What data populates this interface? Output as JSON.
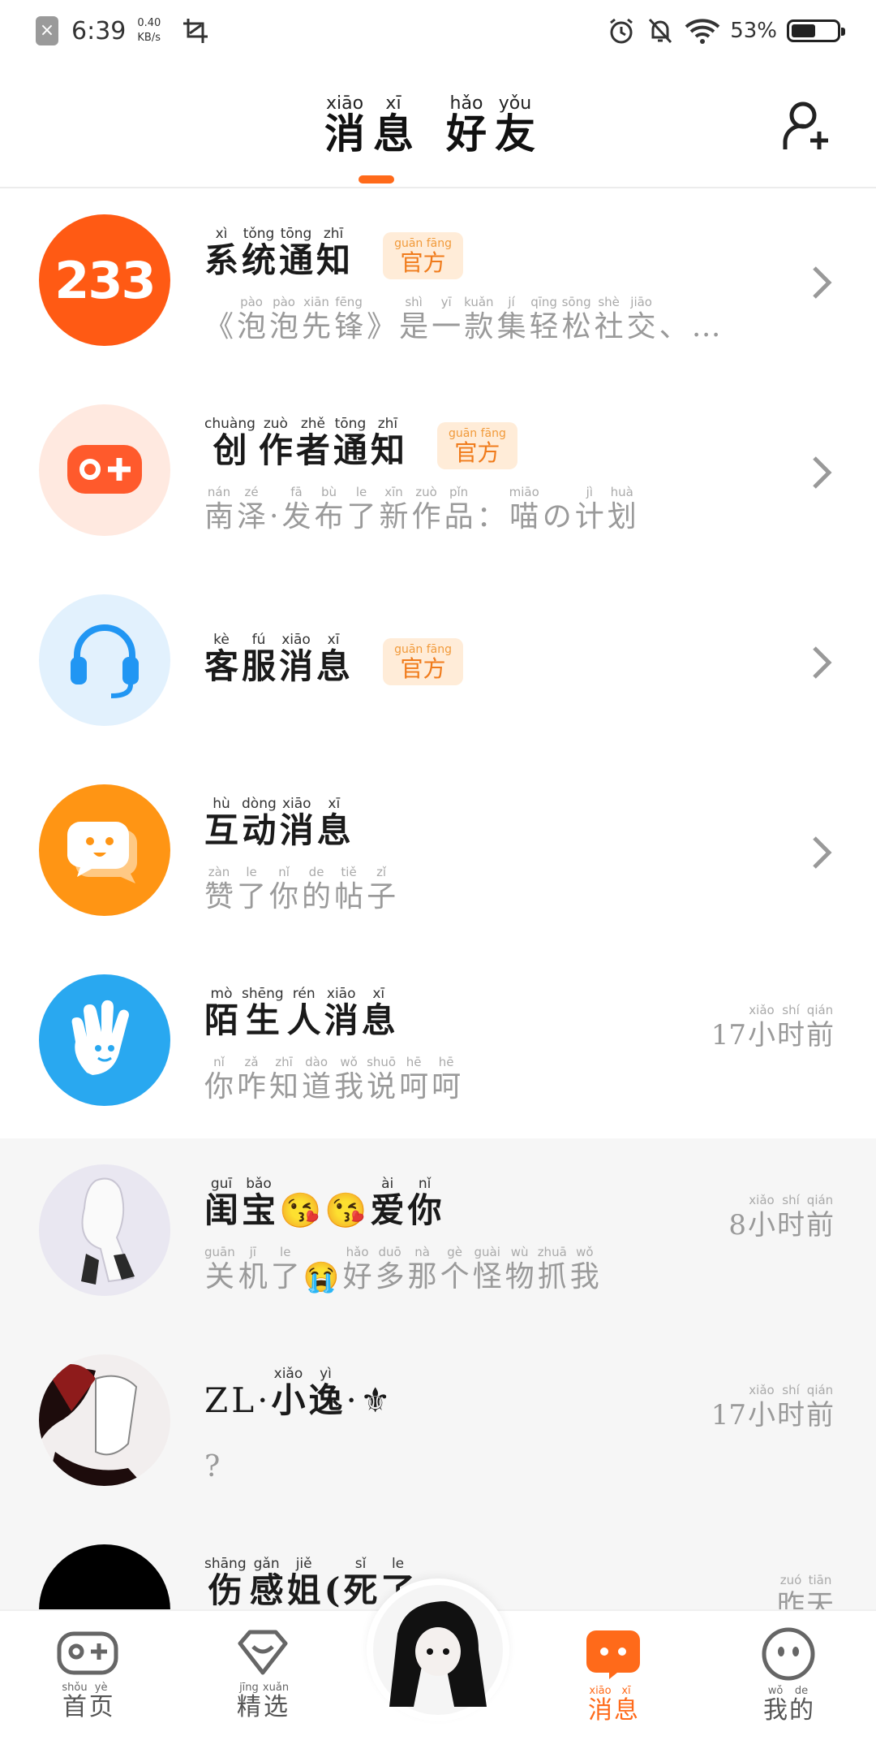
{
  "status_bar": {
    "time": "6:39",
    "speed_value": "0.40",
    "speed_unit": "KB/s",
    "battery_pct": "53%",
    "battery_level": 0.53
  },
  "header": {
    "tabs": [
      {
        "label": "消息",
        "pinyin": [
          "xiāo",
          "xī"
        ],
        "hanzi": [
          "消",
          "息"
        ],
        "active": true
      },
      {
        "label": "好友",
        "pinyin": [
          "hǎo",
          "yǒu"
        ],
        "hanzi": [
          "好",
          "友"
        ],
        "active": false
      }
    ],
    "add_friend_icon": "add-user-icon"
  },
  "rows": [
    {
      "title_pinyin": [
        "xì",
        "tǒng",
        "tōng",
        "zhī"
      ],
      "title_hanzi": [
        "系",
        "统",
        "通",
        "知"
      ],
      "official": true,
      "sub_pinyin": [
        "",
        "pào",
        "pào",
        "xiān",
        "fēng",
        "",
        "shì",
        "yī",
        "kuǎn",
        "jí",
        "qīng",
        "sōng",
        "shè",
        "jiāo",
        "",
        ""
      ],
      "sub_hanzi": [
        "《",
        "泡",
        "泡",
        "先",
        "锋",
        "》",
        "是",
        "一",
        "款",
        "集",
        "轻",
        "松",
        "社",
        "交",
        "、",
        "…"
      ],
      "right": "chevron"
    },
    {
      "title_pinyin": [
        "chuàng",
        "zuò",
        "zhě",
        "tōng",
        "zhī"
      ],
      "title_hanzi": [
        "创",
        "作",
        "者",
        "通",
        "知"
      ],
      "official": true,
      "sub_pinyin": [
        "nán",
        "zé",
        "",
        "fā",
        "bù",
        "le",
        "xīn",
        "zuò",
        "pǐn",
        "",
        "miāo",
        "",
        "jì",
        "huà"
      ],
      "sub_hanzi": [
        "南",
        "泽",
        "·",
        "发",
        "布",
        "了",
        "新",
        "作",
        "品",
        "：",
        "喵",
        "の",
        "计",
        "划"
      ],
      "right": "chevron"
    },
    {
      "title_pinyin": [
        "kè",
        "fú",
        "xiāo",
        "xī"
      ],
      "title_hanzi": [
        "客",
        "服",
        "消",
        "息"
      ],
      "official": true,
      "sub_pinyin": [],
      "sub_hanzi": [],
      "right": "chevron"
    },
    {
      "title_pinyin": [
        "hù",
        "dòng",
        "xiāo",
        "xī"
      ],
      "title_hanzi": [
        "互",
        "动",
        "消",
        "息"
      ],
      "official": false,
      "sub_pinyin": [
        "zàn",
        "le",
        "nǐ",
        "de",
        "tiě",
        "zǐ"
      ],
      "sub_hanzi": [
        "赞",
        "了",
        "你",
        "的",
        "帖",
        "子"
      ],
      "right": "chevron"
    },
    {
      "title_pinyin": [
        "mò",
        "shēng",
        "rén",
        "xiāo",
        "xī"
      ],
      "title_hanzi": [
        "陌",
        "生",
        "人",
        "消",
        "息"
      ],
      "official": false,
      "sub_pinyin": [
        "nǐ",
        "zǎ",
        "zhī",
        "dào",
        "wǒ",
        "shuō",
        "hē",
        "hē"
      ],
      "sub_hanzi": [
        "你",
        "咋",
        "知",
        "道",
        "我",
        "说",
        "呵",
        "呵"
      ],
      "time_num": "17",
      "time_pinyin": [
        "xiǎo",
        "shí",
        "qián"
      ],
      "time_hanzi": [
        "小",
        "时",
        "前"
      ]
    },
    {
      "title_pinyin": [
        "guī",
        "bǎo",
        "",
        "",
        "ài",
        "nǐ"
      ],
      "title_hanzi": [
        "闺",
        "宝",
        "😘",
        "😘",
        "爱",
        "你"
      ],
      "official": false,
      "sub_pinyin": [
        "guān",
        "jī",
        "le",
        "",
        "hǎo",
        "duō",
        "nà",
        "gè",
        "guài",
        "wù",
        "zhuā",
        "wǒ"
      ],
      "sub_hanzi": [
        "关",
        "机",
        "了",
        "😭",
        "好",
        "多",
        "那",
        "个",
        "怪",
        "物",
        "抓",
        "我"
      ],
      "time_num": "8",
      "time_pinyin": [
        "xiǎo",
        "shí",
        "qián"
      ],
      "time_hanzi": [
        "小",
        "时",
        "前"
      ]
    },
    {
      "title_pinyin": [
        "",
        "",
        "",
        "xiǎo",
        "yì",
        "",
        ""
      ],
      "title_hanzi": [
        "Z",
        "L",
        "·",
        "小",
        "逸",
        "·",
        "⚜"
      ],
      "official": false,
      "sub_pinyin": [
        ""
      ],
      "sub_hanzi": [
        "?"
      ],
      "time_num": "17",
      "time_pinyin": [
        "xiǎo",
        "shí",
        "qián"
      ],
      "time_hanzi": [
        "小",
        "时",
        "前"
      ]
    },
    {
      "title_pinyin": [
        "shāng",
        "gǎn",
        "jiě",
        "",
        "sǐ",
        "le"
      ],
      "title_hanzi": [
        "伤",
        "感",
        "姐",
        "(",
        "死",
        "了"
      ],
      "official": false,
      "sub_pinyin": [],
      "sub_hanzi": [],
      "time_num": "",
      "time_pinyin": [
        "zuó",
        "tiān"
      ],
      "time_hanzi": [
        "昨",
        "天"
      ]
    }
  ],
  "official_badge": {
    "pinyin": [
      "guān",
      "fāng"
    ],
    "hanzi": [
      "官",
      "方"
    ],
    "label": "官方"
  },
  "nav": [
    {
      "label": "首页",
      "pinyin": [
        "shǒu",
        "yè"
      ],
      "hanzi": [
        "首",
        "页"
      ],
      "icon": "gamepad-icon",
      "active": false
    },
    {
      "label": "精选",
      "pinyin": [
        "jīng",
        "xuǎn"
      ],
      "hanzi": [
        "精",
        "选"
      ],
      "icon": "heart-diamond-icon",
      "active": false
    },
    {
      "label": "消息",
      "pinyin": [
        "xiāo",
        "xī"
      ],
      "hanzi": [
        "消",
        "息"
      ],
      "icon": "chat-bubble-icon",
      "active": true
    },
    {
      "label": "我的",
      "pinyin": [
        "wǒ",
        "de"
      ],
      "hanzi": [
        "我",
        "的"
      ],
      "icon": "face-icon",
      "active": false
    }
  ],
  "colors": {
    "accent": "#ff6a1a",
    "official_bg": "#ffecd8",
    "gray_row": "#f6f6f6"
  }
}
